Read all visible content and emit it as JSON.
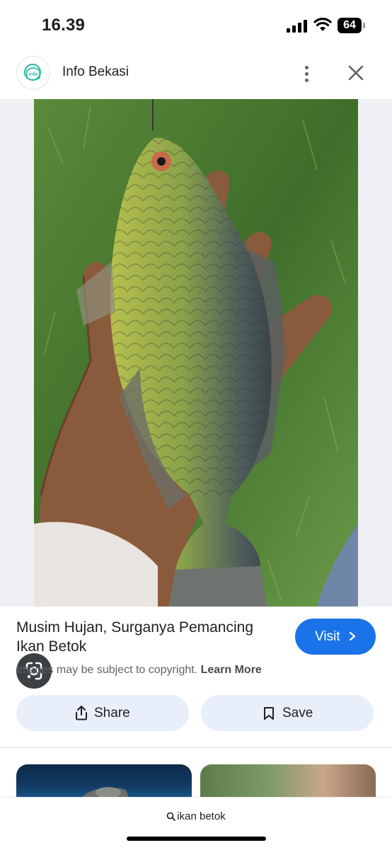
{
  "status_bar": {
    "time": "16.39",
    "battery": "64"
  },
  "header": {
    "site_name": "Info Bekasi",
    "logo_text": "info bekasi"
  },
  "result": {
    "title": "Musim Hujan, Surganya Pemancing Ikan Betok",
    "visit_label": "Visit",
    "copyright_text": "Images may be subject to copyright.",
    "learn_more": "Learn More"
  },
  "actions": {
    "share_label": "Share",
    "save_label": "Save"
  },
  "search": {
    "query": "ikan betok"
  },
  "icons": {
    "more": "more-vert-icon",
    "close": "close-icon",
    "lens": "google-lens-icon",
    "share": "share-icon",
    "save": "bookmark-icon",
    "search": "search-icon"
  },
  "colors": {
    "accent": "#1a73e8",
    "action_bg": "#e8effb",
    "logo": "#25b7a6"
  }
}
